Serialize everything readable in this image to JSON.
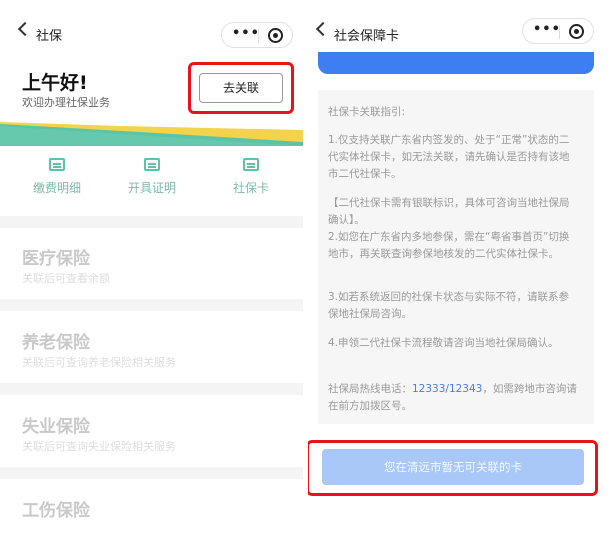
{
  "left": {
    "nav_title": "社保",
    "greeting": "上午好!",
    "greeting_sub": "欢迎办理社保业务",
    "link_button": "去关联",
    "quick_actions": [
      {
        "label": "缴费明细",
        "icon": "yuan-receipt-icon"
      },
      {
        "label": "开具证明",
        "icon": "certificate-icon"
      },
      {
        "label": "社保卡",
        "icon": "card-icon"
      }
    ],
    "insurances": [
      {
        "title": "医疗保险",
        "sub": "关联后可查看余额"
      },
      {
        "title": "养老保险",
        "sub": "关联后可查询养老保险相关服务"
      },
      {
        "title": "失业保险",
        "sub": "关联后可查询失业保险相关服务"
      },
      {
        "title": "工伤保险",
        "sub": ""
      }
    ],
    "colors": {
      "accent_green": "#5bc4a5",
      "wave_yellow": "#f2d34b",
      "highlight_red": "#e8131a"
    }
  },
  "right": {
    "nav_title": "社会保障卡",
    "guide": {
      "heading": "社保卡关联指引:",
      "item1": "1.仅支持关联广东省内签发的、处于“正常”状态的二代实体社保卡，如无法关联，请先确认是否持有该地市二代社保卡。",
      "item2": "【二代社保卡需有银联标识，具体可咨询当地社保局确认】。\n2.如您在广东省内多地参保，需在“粤省事首页”切换地市，再关联查询参保地核发的二代实体社保卡。",
      "item3": "3.如若系统返回的社保卡状态与实际不符，请联系参保地社保局咨询。",
      "item4": "4.申领二代社保卡流程敬请咨询当地社保局确认。",
      "hotline_prefix": "社保局热线电话：",
      "hotline_number": "12333/12343",
      "hotline_suffix": "，如需跨地市咨询请在前方加拨区号。"
    },
    "bottom_button": "您在清远市暂无可关联的卡",
    "colors": {
      "primary_blue": "#3d7ff0",
      "disabled_blue": "#a9c8f7"
    }
  }
}
